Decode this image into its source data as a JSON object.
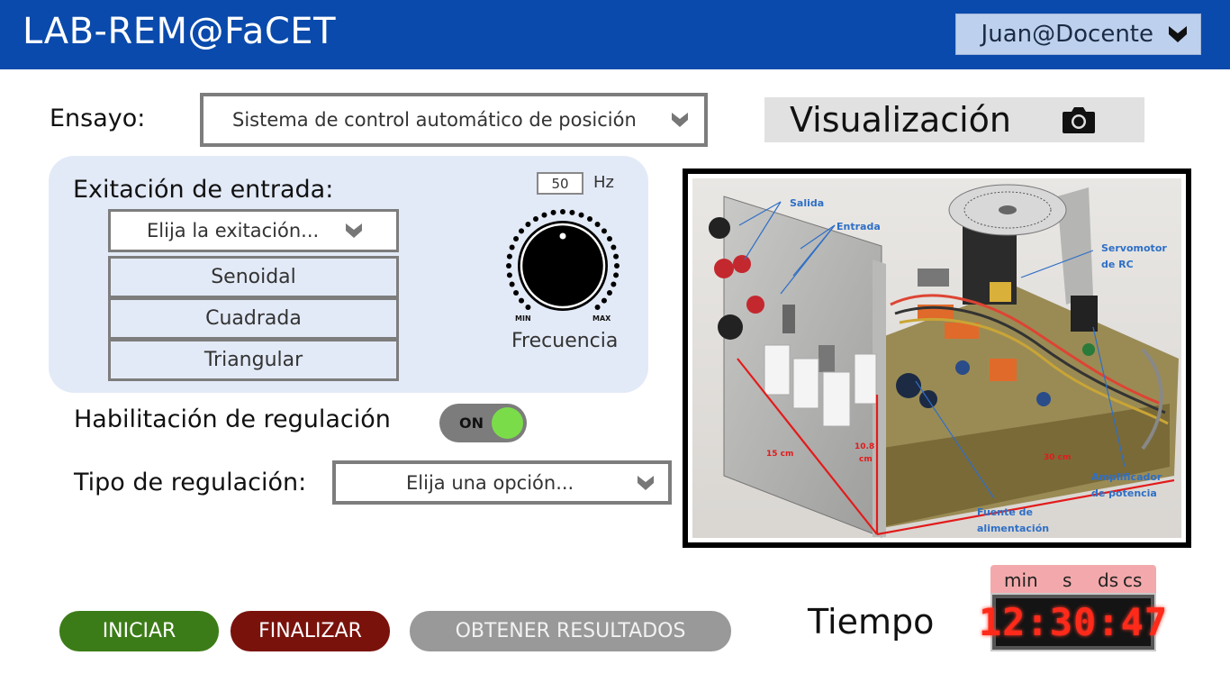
{
  "header": {
    "title": "LAB-REM@FaCET",
    "user_menu": {
      "label": "Juan@Docente",
      "icon": "chevron-down-icon"
    }
  },
  "ensayo": {
    "label": "Ensayo:",
    "selected": "Sistema de control automático de posición"
  },
  "visualizacion": {
    "title": "Visualización",
    "icon": "camera-icon"
  },
  "excitacion": {
    "title": "Exitación de entrada:",
    "placeholder": "Elija la exitación...",
    "options": [
      "Senoidal",
      "Cuadrada",
      "Triangular"
    ],
    "frequency_value": "50",
    "frequency_unit": "Hz",
    "knob_min": "MIN",
    "knob_max": "MAX",
    "knob_label": "Frecuencia",
    "knob_level": 0
  },
  "regulacion": {
    "habilitacion_label": "Habilitación de regulación",
    "toggle_text": "ON",
    "toggle_state": true,
    "tipo_label": "Tipo de regulación:",
    "tipo_placeholder": "Elija una opción..."
  },
  "photo_labels": {
    "salida": "Salida",
    "entrada": "Entrada",
    "servomotor_1": "Servomotor",
    "servomotor_2": "de RC",
    "dim_15": "15 cm",
    "dim_108_1": "10.8",
    "dim_108_2": "cm",
    "dim_30": "30 cm",
    "amplificador_1": "Amplificador",
    "amplificador_2": "de potencia",
    "fuente_1": "Fuente de",
    "fuente_2": "alimentación"
  },
  "buttons": {
    "start": "INICIAR",
    "end": "FINALIZAR",
    "results": "OBTENER  RESULTADOS"
  },
  "tiempo": {
    "label": "Tiempo",
    "units": [
      "min",
      "s",
      "ds",
      "cs"
    ],
    "display": "12:30:47"
  },
  "colors": {
    "header": "#0a4aac",
    "start_button": "#3c7c18",
    "end_button": "#7a120c",
    "results_button": "#999999",
    "toggle_on": "#7bdc4a",
    "timer_digits": "#ff2a1a"
  }
}
